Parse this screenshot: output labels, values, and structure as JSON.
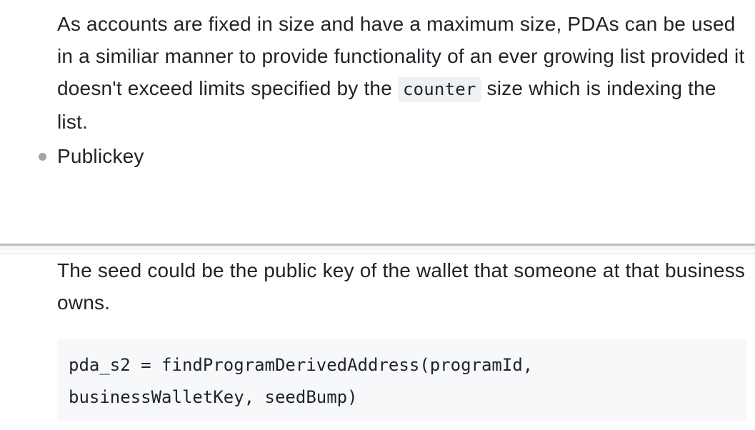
{
  "section1": {
    "paragraph_before_code": "As accounts are fixed in size and have a maximum size, PDAs can be used in a similiar manner to provide functionality of an ever growing list provided it doesn't exceed limits specified by the",
    "inline_code": "counter",
    "paragraph_after_code": " size which is indexing the list.",
    "bullet_item": "Publickey"
  },
  "section2": {
    "paragraph": "The seed could be the public key of the wallet that someone at that business owns.",
    "code_lines": [
      "pda_s2 = findProgramDerivedAddress(programId,",
      "businessWalletKey, seedBump)"
    ]
  }
}
